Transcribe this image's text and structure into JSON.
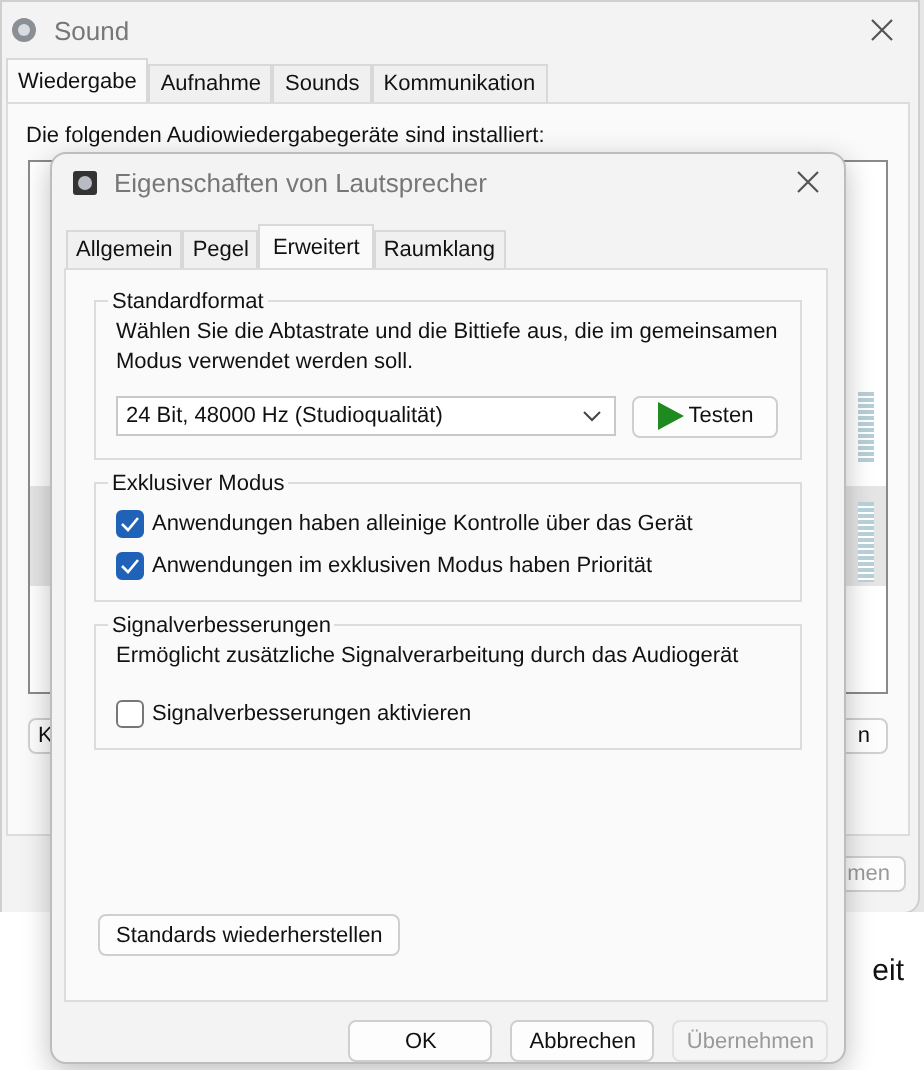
{
  "background_window": {
    "title": "Sound",
    "tabs": [
      {
        "label": "Wiedergabe",
        "selected": true
      },
      {
        "label": "Aufnahme",
        "selected": false
      },
      {
        "label": "Sounds",
        "selected": false
      },
      {
        "label": "Kommunikation",
        "selected": false
      }
    ],
    "intro": "Die folgenden Audiowiedergabegeräte sind installiert:",
    "left_button": "K",
    "right_button": "n",
    "apply_button": "men"
  },
  "background_text": "eit",
  "dialog": {
    "title": "Eigenschaften von Lautsprecher",
    "tabs": [
      {
        "label": "Allgemein",
        "selected": false
      },
      {
        "label": "Pegel",
        "selected": false
      },
      {
        "label": "Erweitert",
        "selected": true
      },
      {
        "label": "Raumklang",
        "selected": false
      }
    ],
    "default_format": {
      "title": "Standardformat",
      "description": "Wählen Sie die Abtastrate und die Bittiefe aus, die im gemeinsamen Modus verwendet werden soll.",
      "format": "24 Bit, 48000 Hz (Studioqualität)",
      "test_button": "Testen"
    },
    "exclusive_mode": {
      "title": "Exklusiver Modus",
      "options": [
        {
          "label": "Anwendungen haben alleinige Kontrolle über das Gerät",
          "checked": true
        },
        {
          "label": "Anwendungen im exklusiven Modus haben Priorität",
          "checked": true
        }
      ]
    },
    "enhancements": {
      "title": "Signalverbesserungen",
      "description": "Ermöglicht zusätzliche Signalverarbeitung durch das Audiogerät",
      "options": [
        {
          "label": "Signalverbesserungen aktivieren",
          "checked": false
        }
      ]
    },
    "restore_button": "Standards wiederherstellen",
    "buttons": [
      {
        "label": "OK",
        "disabled": false
      },
      {
        "label": "Abbrechen",
        "disabled": false
      },
      {
        "label": "Übernehmen",
        "disabled": true
      }
    ]
  }
}
